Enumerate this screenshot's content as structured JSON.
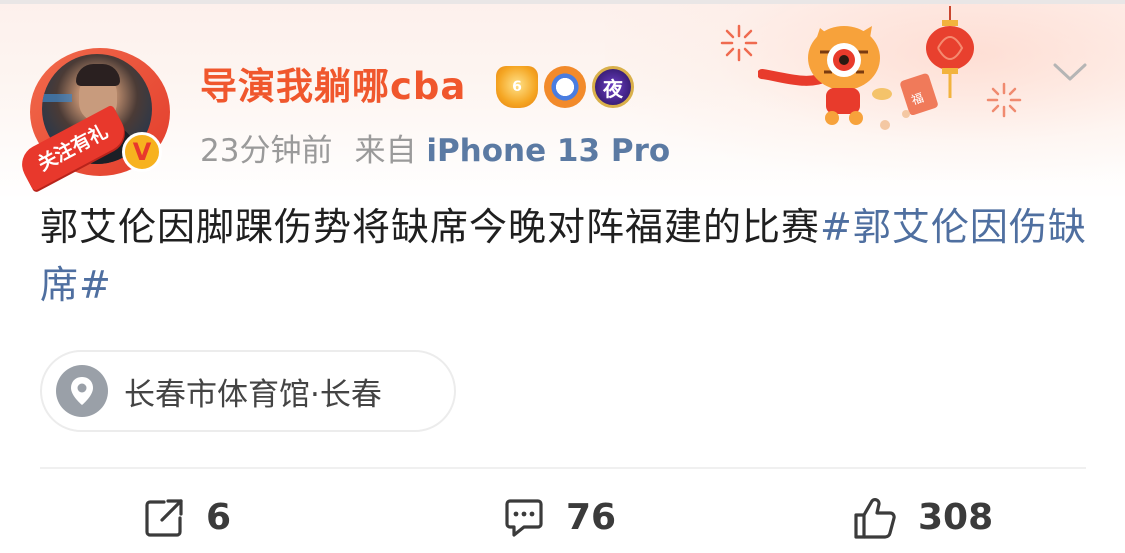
{
  "user": {
    "name": "导演我躺哪cba",
    "follow_badge": "关注有礼",
    "verified_mark": "V",
    "badges": [
      {
        "name": "crown-badge",
        "text": "6"
      },
      {
        "name": "eye-badge",
        "text": ""
      },
      {
        "name": "night-badge",
        "text": "夜"
      }
    ]
  },
  "meta": {
    "time": "23分钟前",
    "source_prefix": "来自",
    "device": "iPhone 13 Pro"
  },
  "post": {
    "text": "郭艾伦因脚踝伤势将缺席今晚对阵福建的比赛",
    "hashtag": "#郭艾伦因伤缺席#"
  },
  "location": {
    "icon": "location-pin-icon",
    "text": "长春市体育馆·长春"
  },
  "actions": {
    "repost_count": "6",
    "comment_count": "76",
    "like_count": "308"
  },
  "colors": {
    "username": "#f0572d",
    "hashtag": "#4f6fa0",
    "device": "#5b7aa3",
    "meta": "#9a9a9a",
    "text": "#1f1f1f"
  }
}
